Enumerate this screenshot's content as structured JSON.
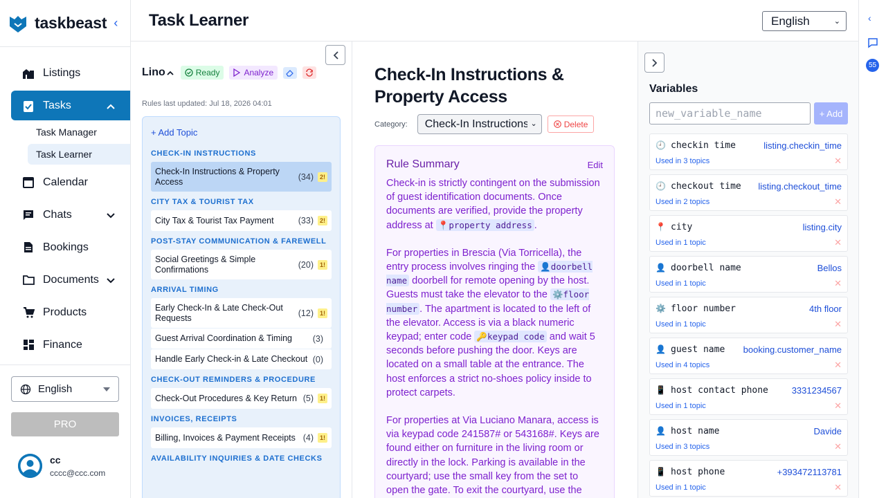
{
  "brand": {
    "name": "taskbeast"
  },
  "nav": {
    "items": [
      {
        "label": "Listings"
      },
      {
        "label": "Tasks"
      },
      {
        "label": "Calendar"
      },
      {
        "label": "Chats"
      },
      {
        "label": "Bookings"
      },
      {
        "label": "Documents"
      },
      {
        "label": "Products"
      },
      {
        "label": "Finance"
      }
    ],
    "sub_items": [
      {
        "label": "Task Manager"
      },
      {
        "label": "Task Learner"
      }
    ],
    "language": "English",
    "pro_label": "PRO",
    "user": {
      "name": "cc",
      "email": "cccc@ccc.com"
    }
  },
  "header": {
    "title": "Task Learner",
    "language": "English"
  },
  "rail": {
    "badge": "55"
  },
  "topics": {
    "listing_name": "Lino",
    "ready_label": "Ready",
    "analyze_label": "Analyze",
    "rules_updated": "Rules last updated: Jul 18, 2026 04:01",
    "add_topic": "+ Add Topic",
    "categories": [
      {
        "name": "CHECK-IN INSTRUCTIONS",
        "items": [
          {
            "name": "Check-In Instructions & Property Access",
            "count": "(34)",
            "warn": "2!"
          }
        ]
      },
      {
        "name": "CITY TAX & TOURIST TAX",
        "items": [
          {
            "name": "City Tax & Tourist Tax Payment",
            "count": "(33)",
            "warn": "2!"
          }
        ]
      },
      {
        "name": "POST-STAY COMMUNICATION & FAREWELL",
        "items": [
          {
            "name": "Social Greetings & Simple Confirmations",
            "count": "(20)",
            "warn": "1!"
          }
        ]
      },
      {
        "name": "ARRIVAL TIMING",
        "items": [
          {
            "name": "Early Check-In & Late Check-Out Requests",
            "count": "(12)",
            "warn": "1!"
          },
          {
            "name": "Guest Arrival Coordination & Timing",
            "count": "(3)",
            "warn": ""
          },
          {
            "name": "Handle Early Check-in & Late Checkout",
            "count": "(0)",
            "warn": ""
          }
        ]
      },
      {
        "name": "CHECK-OUT REMINDERS & PROCEDURE",
        "items": [
          {
            "name": "Check-Out Procedures & Key Return",
            "count": "(5)",
            "warn": "1!"
          }
        ]
      },
      {
        "name": "INVOICES, RECEIPTS",
        "items": [
          {
            "name": "Billing, Invoices & Payment Receipts",
            "count": "(4)",
            "warn": "1!"
          }
        ]
      },
      {
        "name": "AVAILABILITY INQUIRIES & DATE CHECKS",
        "items": []
      }
    ]
  },
  "rule": {
    "title": "Check-In Instructions & Property Access",
    "category_label": "Category:",
    "category_value": "Check-In Instructions",
    "delete_label": "Delete",
    "summary_title": "Rule Summary",
    "edit_label": "Edit",
    "p1_a": "Check-in is strictly contingent on the submission of guest identification documents. Once documents are verified, provide the property address at ",
    "p1_pill": "📍property address",
    "p1_b": ".",
    "p2_a": "For properties in Brescia (Via Torricella), the entry process involves ringing the ",
    "p2_pill1": "👤doorbell name",
    "p2_b": " doorbell for remote opening by the host. Guests must take the elevator to the ",
    "p2_pill2": "⚙️floor number",
    "p2_c": ". The apartment is located to the left of the elevator. Access is via a black numeric keypad; enter code ",
    "p2_pill3": "🔑keypad code",
    "p2_d": " and wait 5 seconds before pushing the door. Keys are located on a small table at the entrance. The host enforces a strict no-shoes policy inside to protect carpets.",
    "p3": "For properties at Via Luciano Manara, access is via keypad code 241587# or 543168#. Keys are found either on furniture in the living room or directly in the lock. Parking is available in the courtyard; use the small key from the set to open the gate. To exit the courtyard, use the"
  },
  "variables": {
    "title": "Variables",
    "input_placeholder": "new_variable_name",
    "add_label": "+ Add",
    "items": [
      {
        "icon": "clock-icon",
        "glyph": "🕘",
        "name": "checkin time",
        "value": "listing.checkin_time",
        "used": "Used in 3 topics"
      },
      {
        "icon": "clock-icon",
        "glyph": "🕘",
        "name": "checkout time",
        "value": "listing.checkout_time",
        "used": "Used in 2 topics"
      },
      {
        "icon": "pin-icon",
        "glyph": "📍",
        "name": "city",
        "value": "listing.city",
        "used": "Used in 1 topic"
      },
      {
        "icon": "person-icon",
        "glyph": "👤",
        "name": "doorbell name",
        "value": "Bellos",
        "used": "Used in 1 topic"
      },
      {
        "icon": "gear-icon",
        "glyph": "⚙️",
        "name": "floor number",
        "value": "4th floor",
        "used": "Used in 1 topic"
      },
      {
        "icon": "person-icon",
        "glyph": "👤",
        "name": "guest name",
        "value": "booking.customer_name",
        "used": "Used in 4 topics"
      },
      {
        "icon": "phone-icon",
        "glyph": "📱",
        "name": "host contact phone",
        "value": "3331234567",
        "used": "Used in 1 topic"
      },
      {
        "icon": "person-icon",
        "glyph": "👤",
        "name": "host name",
        "value": "Davide",
        "used": "Used in 3 topics"
      },
      {
        "icon": "phone-icon",
        "glyph": "📱",
        "name": "host phone",
        "value": "+393472113781",
        "used": "Used in 1 topic"
      }
    ]
  },
  "colors": {
    "primary": "#0e76b8",
    "accent": "#2563eb",
    "summary_text": "#7e22ce"
  }
}
